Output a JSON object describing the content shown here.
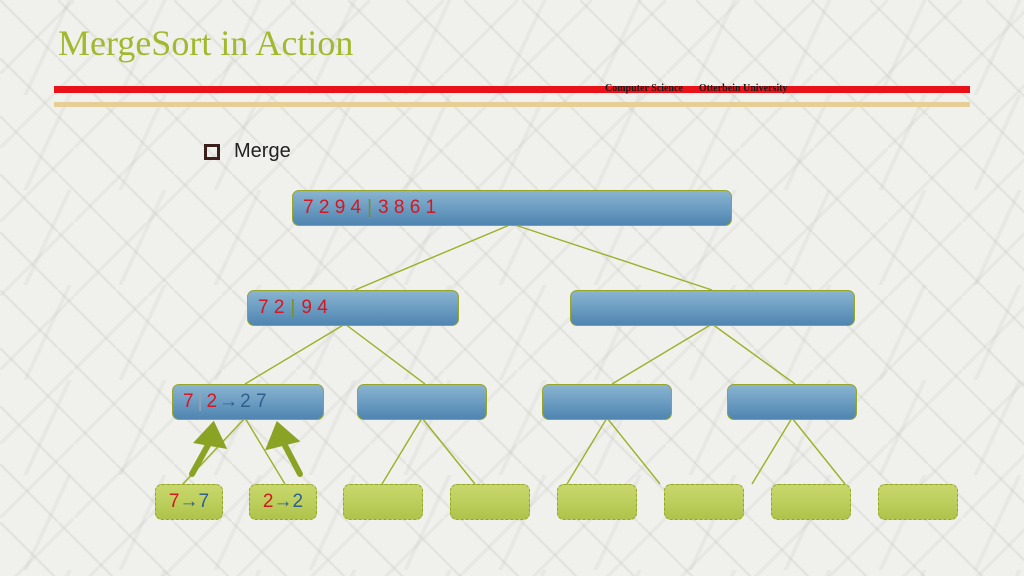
{
  "title": "MergeSort in Action",
  "affiliation": {
    "left": "Computer Science",
    "right": "Otterbein University"
  },
  "bullet": "Merge",
  "colors": {
    "red": "#d41720",
    "blue": "#2f5f8f",
    "olive": "#7a8f22",
    "accent_red": "#e81218"
  },
  "tree": {
    "root": {
      "left": "7 2 9 4",
      "sep": "|",
      "right": "3 8 6 1"
    },
    "level1_left": {
      "left": "7 2",
      "sep": "|",
      "right": "9 4"
    },
    "level2_left": {
      "a": "7",
      "sep": "|",
      "b": "2",
      "arrow": "→",
      "res": "2 7"
    },
    "leaf1": {
      "in": "7",
      "arrow": "→",
      "out": "7"
    },
    "leaf2": {
      "in": "2",
      "arrow": "→",
      "out": "2"
    }
  }
}
